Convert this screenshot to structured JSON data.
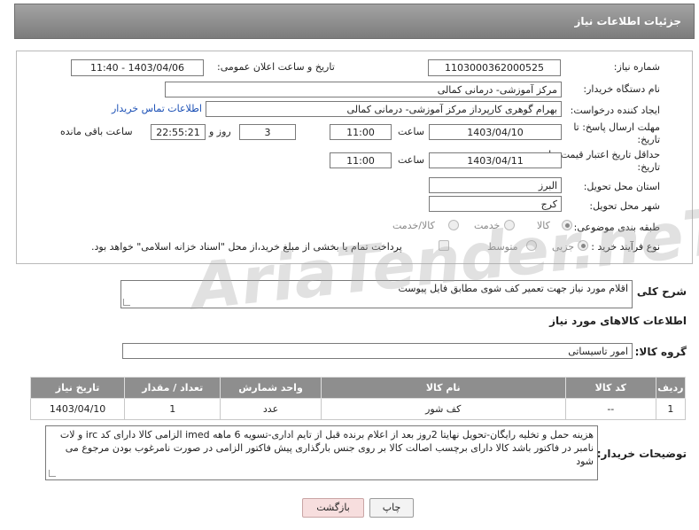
{
  "header": {
    "title": "جزئیات اطلاعات نیاز"
  },
  "form": {
    "need_number": {
      "label": "شماره نیاز:",
      "value": "1103000362000525"
    },
    "announce_datetime": {
      "label": "تاریخ و ساعت اعلان عمومی:",
      "value": "1403/04/06 - 11:40"
    },
    "buyer_org": {
      "label": "نام دستگاه خریدار:",
      "value": "مرکز آموزشی- درمانی کمالی"
    },
    "requester": {
      "label": "ایجاد کننده درخواست:",
      "value": "بهرام گوهری کارپرداز مرکز آموزشی- درمانی کمالی",
      "contact_link": "اطلاعات تماس خریدار"
    },
    "reply_deadline": {
      "label_line1": "مهلت ارسال پاسخ: تا",
      "label_line2": "تاریخ:",
      "date": "1403/04/10",
      "time_label": "ساعت",
      "time": "11:00",
      "days": "3",
      "days_label": "روز و",
      "remaining": "22:55:21",
      "remaining_label": "ساعت باقی مانده"
    },
    "price_validity": {
      "label_line1": "حداقل تاریخ اعتبار قیمت: تا",
      "label_line2": "تاریخ:",
      "date": "1403/04/11",
      "time_label": "ساعت",
      "time": "11:00"
    },
    "province": {
      "label": "استان محل تحویل:",
      "value": "البرز"
    },
    "city": {
      "label": "شهر محل تحویل:",
      "value": "کرج"
    },
    "category": {
      "label": "طبقه بندی موضوعی:",
      "options": [
        "کالا",
        "خدمت",
        "کالا/خدمت"
      ],
      "selected": "کالا"
    },
    "purchase_type": {
      "label": "نوع فرآیند خرید :",
      "options": [
        "جزیی",
        "متوسط"
      ],
      "selected": "جزیی",
      "treasury_note": "پرداخت تمام یا بخشی از مبلغ خرید،از محل \"اسناد خزانه اسلامی\" خواهد بود."
    }
  },
  "description": {
    "label": "شرح کلی نیاز:",
    "value": "اقلام مورد نیاز جهت تعمیر کف شوی مطابق فایل پیوست"
  },
  "goods_info": {
    "title": "اطلاعات کالاهای مورد نیاز",
    "group_label": "گروه کالا:",
    "group_value": "امور تاسیساتی",
    "columns": [
      "ردیف",
      "کد کالا",
      "نام کالا",
      "واحد شمارش",
      "تعداد / مقدار",
      "تاریخ نیاز"
    ],
    "rows": [
      {
        "row": "1",
        "code": "--",
        "name": "کف شور",
        "unit": "عدد",
        "qty": "1",
        "date": "1403/04/10"
      }
    ]
  },
  "buyer_notes": {
    "label": "توضیحات خریدار:",
    "value": "هزینه حمل و تخلیه رایگان-تحویل نهایتا 2روز بعد از اعلام برنده قبل از تایم اداری-تسویه 6 ماهه imed الزامی کالا دارای کد irc و لات نامبر در فاکتور باشد کالا دارای برچسب اصالت کالا بر روی جنس بارگذاری پیش فاکتور الزامی در صورت نامرغوب بودن مرجوع می شود"
  },
  "buttons": {
    "print": "چاپ",
    "back": "بازگشت"
  },
  "watermark": "AriaTender.neT",
  "colors": {
    "header": "#8e8e8e",
    "link": "#1a4fb5",
    "back_button": "#f7dede"
  }
}
